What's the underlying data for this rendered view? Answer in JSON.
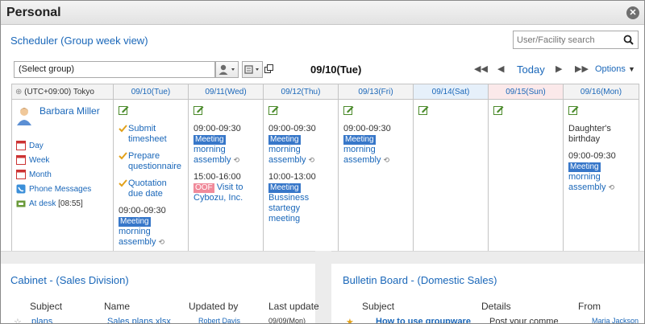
{
  "window": {
    "title": "Personal",
    "close_icon": "close-icon"
  },
  "scheduler": {
    "title": "Scheduler (Group week view)",
    "search_placeholder": "User/Facility search",
    "group_select": "(Select group)",
    "current_date": "09/10(Tue)",
    "today_label": "Today",
    "options_label": "Options",
    "timezone": "(UTC+09:00) Tokyo",
    "days": [
      {
        "label": "09/10(Tue)"
      },
      {
        "label": "09/11(Wed)"
      },
      {
        "label": "09/12(Thu)"
      },
      {
        "label": "09/13(Fri)"
      },
      {
        "label": "09/14(Sat)"
      },
      {
        "label": "09/15(Sun)"
      },
      {
        "label": "09/16(Mon)"
      }
    ],
    "user": {
      "name": "Barbara Miller",
      "links": [
        "Day",
        "Week",
        "Month",
        "Phone Messages",
        "At desk"
      ],
      "at_desk_time": "[08:55]"
    },
    "tue": {
      "tasks": [
        "Submit timesheet",
        "Prepare questionnaire",
        "Quotation due date"
      ],
      "event_time": "09:00-09:30",
      "event_badge": "Meeting",
      "event_title": "morning assembly"
    },
    "wed": {
      "event1_time": "09:00-09:30",
      "event1_badge": "Meeting",
      "event1_title": "morning assembly",
      "event2_time": "15:00-16:00",
      "event2_badge": "OOF",
      "event2_title": "Visit to Cybozu, Inc."
    },
    "thu": {
      "event1_time": "09:00-09:30",
      "event1_badge": "Meeting",
      "event1_title": "morning assembly",
      "event2_time": "10:00-13:00",
      "event2_badge": "Meeting",
      "event2_title": "Bussiness startegy meeting"
    },
    "fri": {
      "event_time": "09:00-09:30",
      "event_badge": "Meeting",
      "event_title": "morning assembly"
    },
    "mon": {
      "note": "Daughter's birthday",
      "event_time": "09:00-09:30",
      "event_badge": "Meeting",
      "event_title": "morning assembly"
    }
  },
  "cabinet": {
    "title": "Cabinet - (Sales Division)",
    "columns": [
      "Subject",
      "Name",
      "Updated by",
      "Last update"
    ],
    "row": {
      "subject": "plans",
      "name": "Sales plans.xlsx",
      "updated_by": "Robert Davis",
      "last_update": "09/09(Mon)"
    }
  },
  "bulletin": {
    "title": "Bulletin Board - (Domestic Sales)",
    "columns": [
      "Subject",
      "Details",
      "From"
    ],
    "row": {
      "subject": "How to use groupware",
      "details": "Post your comme",
      "from": "Maria Jackson"
    }
  },
  "colors": {
    "link": "#1a67b9",
    "meeting_badge": "#3777c9",
    "oof_badge": "#f08a9a",
    "sat_header": "#e6f0fa",
    "sun_header": "#fbe9ea"
  }
}
